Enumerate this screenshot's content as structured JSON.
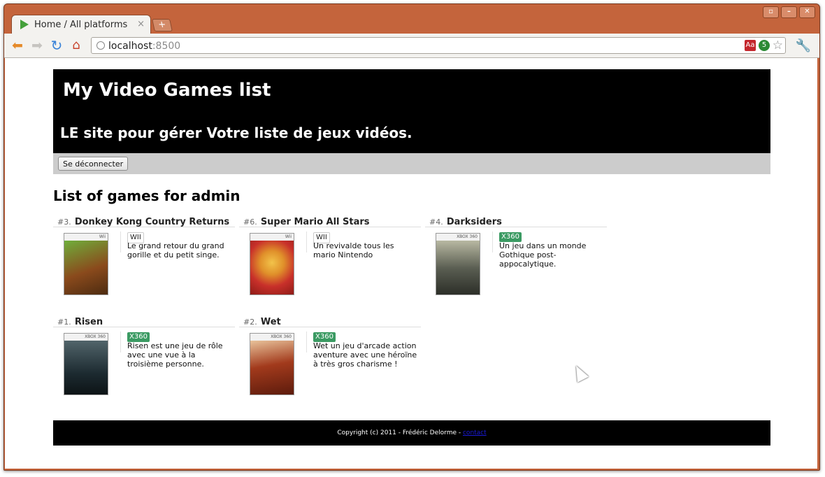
{
  "browser": {
    "tab_title": "Home / All platforms",
    "tab_close": "×",
    "new_tab": "+",
    "url_host": "localhost",
    "url_port": ":8500",
    "extension_badge_count": "5",
    "extension_a_label": "Aa",
    "window_buttons": [
      "▫",
      "–",
      "✕"
    ]
  },
  "site": {
    "title": "My Video Games list",
    "tagline": "LE site pour gérer Votre liste de jeux vidéos.",
    "logout_label": "Se déconnecter"
  },
  "list": {
    "title": "List of games for admin",
    "games": [
      {
        "rank": "#3.",
        "name": "Donkey Kong Country Returns",
        "platform": "WII",
        "description": "Le grand retour du grand gorille et du petit singe.",
        "cover_band": "Wii",
        "cover_colors": [
          "#6fae3b",
          "#8a4a1c"
        ]
      },
      {
        "rank": "#6.",
        "name": "Super Mario All Stars",
        "platform": "WII",
        "description": "Un revivalde tous les mario Nintendo",
        "cover_band": "Wii",
        "cover_colors": [
          "#c8302a",
          "#f2c34a"
        ]
      },
      {
        "rank": "#4.",
        "name": "Darksiders",
        "platform": "X360",
        "description": "Un jeu dans un monde Gothique post-appocalytique.",
        "cover_band": "XBOX 360",
        "cover_colors": [
          "#5a5e52",
          "#b8b8a2"
        ]
      },
      {
        "rank": "#1.",
        "name": "Risen",
        "platform": "X360",
        "description": "Risen est une jeu de rôle avec une vue à la troisième personne.",
        "cover_band": "XBOX 360",
        "cover_colors": [
          "#1c2a30",
          "#51646a"
        ]
      },
      {
        "rank": "#2.",
        "name": "Wet",
        "platform": "X360",
        "description": "Wet un jeu d'arcade action aventure avec une héroïne à très gros charisme !",
        "cover_band": "XBOX 360",
        "cover_colors": [
          "#a23a1c",
          "#e8c29a"
        ]
      }
    ]
  },
  "footer": {
    "copyright": "Copyright (c) 2011 - Frédéric Delorme -",
    "contact_label": "contact"
  }
}
